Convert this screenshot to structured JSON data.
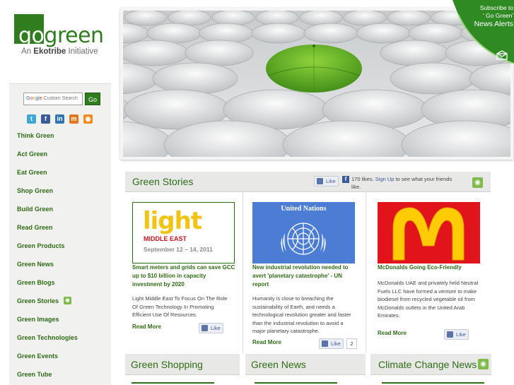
{
  "logo": {
    "go": "go",
    "green": "green",
    "tagline_prefix": "An",
    "tagline_brand": "Ekotribe",
    "tagline_suffix": "Initiative"
  },
  "subscribe": {
    "line1": "Subscribe to",
    "line2": "' Go Green'",
    "line3": "News Alerts"
  },
  "search": {
    "google": [
      "G",
      "o",
      "o",
      "g",
      "l",
      "e"
    ],
    "placeholder": "Custom Search",
    "button": "Go"
  },
  "social_icons": [
    "twitter-icon",
    "facebook-icon",
    "linkedin-icon",
    "myspace-icon",
    "rss-icon"
  ],
  "nav": [
    {
      "label": "Think Green"
    },
    {
      "label": "Act Green"
    },
    {
      "label": "Eat Green"
    },
    {
      "label": "Shop Green"
    },
    {
      "label": "Build Green"
    },
    {
      "label": "Read Green"
    },
    {
      "label": "Green Products"
    },
    {
      "label": "Green News"
    },
    {
      "label": "Green Blogs"
    },
    {
      "label": "Green Stories"
    },
    {
      "label": "Green Images"
    },
    {
      "label": "Green Technologies"
    },
    {
      "label": "Green Events"
    },
    {
      "label": "Green Tube"
    }
  ],
  "stories_section": {
    "title": "Green Stories",
    "like_label": "Like",
    "facebook_likes": "170 likes.",
    "signup": "Sign Up",
    "facebook_suffix": "to see what your friends like."
  },
  "stories": [
    {
      "image": {
        "word": "light",
        "sub": "MIDDLE EAST",
        "date": "September 12 – 14, 2011"
      },
      "title": "Smart meters and grids can save GCC up to $10 billion in capacity investment by 2020",
      "body": "Light Middle East To Focus On The Role Of Green Technology In Promoting Efficient Use Of Resources.",
      "read_more": "Read More",
      "like_label": "Like"
    },
    {
      "image": {
        "org": "United Nations"
      },
      "title": "New industrial revolution needed to avert 'planetary catastrophe' - UN report",
      "body": "Humanity is close to breaching the sustainability of Earth, and needs a technological revolution greater and faster than the industrial revolution to avoid a major planetary catastrophe.",
      "read_more": "Read More",
      "like_label": "Like",
      "like_count": "2"
    },
    {
      "title": "McDonalds Going Eco-Friendly",
      "body": "McDonalds UAE and privately held Neutral Fuels LLC have formed a venture to make biodiesel from recycled vegetable oil from McDonalds outlets in the United Arab Emirates.",
      "read_more": "Read More",
      "like_label": "Like"
    }
  ],
  "bottom_tabs": [
    {
      "title": "Green Shopping"
    },
    {
      "title": "Green News"
    },
    {
      "title": "Climate Change News"
    }
  ],
  "colors": {
    "brand_green": "#2e6c15",
    "logo_green": "#2f7d1e",
    "umbrella_green": "#5fae2a",
    "facebook_blue": "#3b5998"
  }
}
